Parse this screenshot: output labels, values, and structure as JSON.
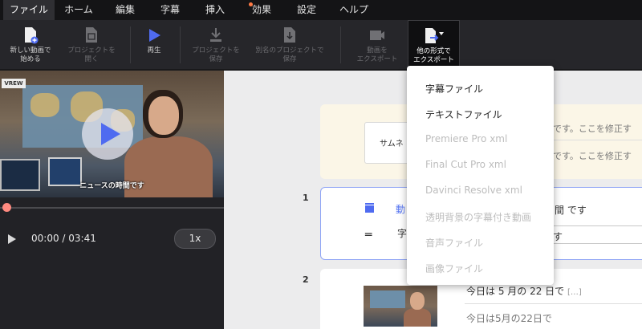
{
  "menu": {
    "items": [
      {
        "label": "ファイル"
      },
      {
        "label": "ホーム"
      },
      {
        "label": "編集"
      },
      {
        "label": "字幕"
      },
      {
        "label": "挿入"
      },
      {
        "label": "効果"
      },
      {
        "label": "設定"
      },
      {
        "label": "ヘルプ"
      }
    ],
    "active_index": 0,
    "dot_color": "#ff7a45"
  },
  "toolbar": {
    "new_project": "新しい動画で\n始める",
    "open_project": "プロジェクトを\n開く",
    "play": "再生",
    "save_project": "プロジェクトを\n保存",
    "save_as": "別名のプロジェクトで\n保存",
    "export_video": "動画を\nエクスポート",
    "export_other": "他の形式で\nエクスポート"
  },
  "player": {
    "subtitle": "ニュースの時間です",
    "watermark": "VREW",
    "time": "00:00 / 03:41",
    "speed": "1x"
  },
  "editor": {
    "thumb_label": "サムネ",
    "row0_line1": "です。ここを修正す",
    "row0_line2": "です。ここを修正す",
    "clip1": {
      "number": "1",
      "blue_text": "動",
      "right_text": "間 です",
      "sub_label": "字",
      "input_text": "す"
    },
    "clip2": {
      "number": "2",
      "line1": "今日は 5 月の 22 日で",
      "more": "[…]",
      "line2": "今日は5月の22日で"
    }
  },
  "export_menu": {
    "items": [
      {
        "label": "字幕ファイル",
        "enabled": true
      },
      {
        "label": "テキストファイル",
        "enabled": true
      },
      {
        "label": "Premiere Pro xml",
        "enabled": false
      },
      {
        "label": "Final Cut Pro xml",
        "enabled": false
      },
      {
        "label": "Davinci Resolve xml",
        "enabled": false
      },
      {
        "label": "透明背景の字幕付き動画",
        "enabled": false
      },
      {
        "label": "音声ファイル",
        "enabled": false
      },
      {
        "label": "画像ファイル",
        "enabled": false
      }
    ]
  },
  "colors": {
    "accent": "#4f6bf0",
    "menubar_bg": "#141416",
    "toolbar_bg": "#26262a",
    "editor_bg": "#ececed"
  }
}
